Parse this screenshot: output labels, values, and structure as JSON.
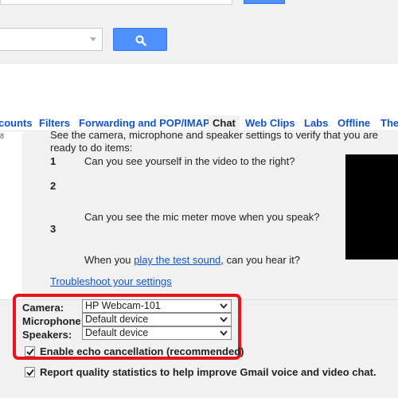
{
  "colors": {
    "accent": "#4d90fe",
    "link": "#1155cc",
    "highlight": "#e8161a"
  },
  "header": {
    "search_button_icon": "search-icon"
  },
  "tabs": [
    {
      "label": "counts",
      "active": false
    },
    {
      "label": "Filters",
      "active": false
    },
    {
      "label": "Forwarding and POP/IMAP",
      "active": false
    },
    {
      "label": "Chat",
      "active": true
    },
    {
      "label": "Web Clips",
      "active": false
    },
    {
      "label": "Labs",
      "active": false
    },
    {
      "label": "Offline",
      "active": false
    },
    {
      "label": "Ther",
      "active": false
    }
  ],
  "gutter": {
    "number": "8"
  },
  "content": {
    "intro": "See the camera, microphone and speaker settings to verify that you are ready to do items:",
    "steps": [
      {
        "num": "1",
        "text": "Can you see yourself in the video to the right?"
      },
      {
        "num": "2",
        "text": "Can you see the mic meter move when you speak?"
      },
      {
        "num": "3",
        "text_before": "When you ",
        "link": "play the test sound",
        "text_after": ", can you hear it?"
      }
    ],
    "troubleshoot_link": "Troubleshoot your settings"
  },
  "devices": {
    "camera_label": "Camera:",
    "camera_value": "HP Webcam-101",
    "microphone_label": "Microphone:",
    "microphone_value": "Default device",
    "speakers_label": "Speakers:",
    "speakers_value": "Default device",
    "echo_label": "Enable echo cancellation (recommended)",
    "echo_checked": true,
    "stats_label": "Report quality statistics to help improve Gmail voice and video chat.",
    "stats_checked": true
  }
}
